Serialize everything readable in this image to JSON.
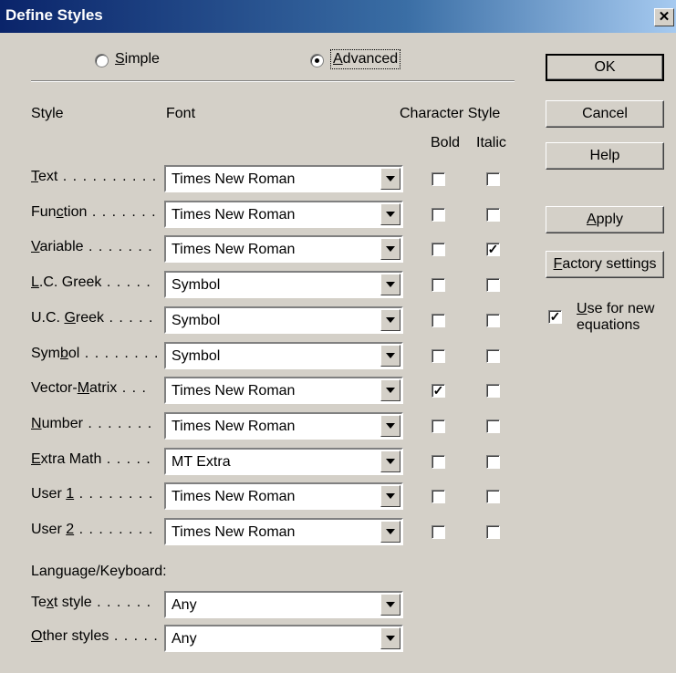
{
  "title": "Define Styles",
  "mode": {
    "simple": {
      "pre": "",
      "u": "S",
      "post": "imple",
      "selected": false
    },
    "advanced": {
      "pre": "",
      "u": "A",
      "post": "dvanced",
      "selected": true
    }
  },
  "headers": {
    "style": "Style",
    "font": "Font",
    "character_style": "Character Style",
    "bold": "Bold",
    "italic": "Italic"
  },
  "styles": [
    {
      "pre": "",
      "u": "T",
      "post": "ext",
      "dots": " . . . . . . . . . .",
      "font": "Times New Roman",
      "bold": false,
      "italic": false
    },
    {
      "pre": "Fun",
      "u": "c",
      "post": "tion",
      "dots": " . . . . . . .",
      "font": "Times New Roman",
      "bold": false,
      "italic": false
    },
    {
      "pre": "",
      "u": "V",
      "post": "ariable",
      "dots": " . . . . . . .",
      "font": "Times New Roman",
      "bold": false,
      "italic": true
    },
    {
      "pre": "",
      "u": "L",
      "post": ".C. Greek",
      "dots": " . . . . .",
      "font": "Symbol",
      "bold": false,
      "italic": false
    },
    {
      "pre": "U.C. ",
      "u": "G",
      "post": "reek",
      "dots": " . . . . .",
      "font": "Symbol",
      "bold": false,
      "italic": false
    },
    {
      "pre": "Sym",
      "u": "b",
      "post": "ol",
      "dots": " . . . . . . . .",
      "font": "Symbol",
      "bold": false,
      "italic": false
    },
    {
      "pre": "Vector-",
      "u": "M",
      "post": "atrix",
      "dots": " . . .",
      "font": "Times New Roman",
      "bold": true,
      "italic": false
    },
    {
      "pre": "",
      "u": "N",
      "post": "umber",
      "dots": " . . . . . . .",
      "font": "Times New Roman",
      "bold": false,
      "italic": false
    },
    {
      "pre": "",
      "u": "E",
      "post": "xtra Math",
      "dots": " . . . . .",
      "font": "MT Extra",
      "bold": false,
      "italic": false
    },
    {
      "pre": "User ",
      "u": "1",
      "post": "",
      "dots": " . . . . . . . .",
      "font": "Times New Roman",
      "bold": false,
      "italic": false
    },
    {
      "pre": "User ",
      "u": "2",
      "post": "",
      "dots": " . . . . . . . .",
      "font": "Times New Roman",
      "bold": false,
      "italic": false
    }
  ],
  "language": {
    "heading": "Language/Keyboard:",
    "rows": [
      {
        "pre": "Te",
        "u": "x",
        "post": "t style",
        "dots": " . . . . . .",
        "value": "Any"
      },
      {
        "pre": "",
        "u": "O",
        "post": "ther styles",
        "dots": " . . . . .",
        "value": "Any"
      }
    ]
  },
  "buttons": {
    "ok": "OK",
    "cancel": "Cancel",
    "help": "Help",
    "apply": {
      "pre": "",
      "u": "A",
      "post": "pply"
    },
    "factory": {
      "pre": "",
      "u": "F",
      "post": "actory settings"
    }
  },
  "use_for_new": {
    "pre": "",
    "u": "U",
    "post": "se for new",
    "line2": "equations",
    "checked": true
  }
}
